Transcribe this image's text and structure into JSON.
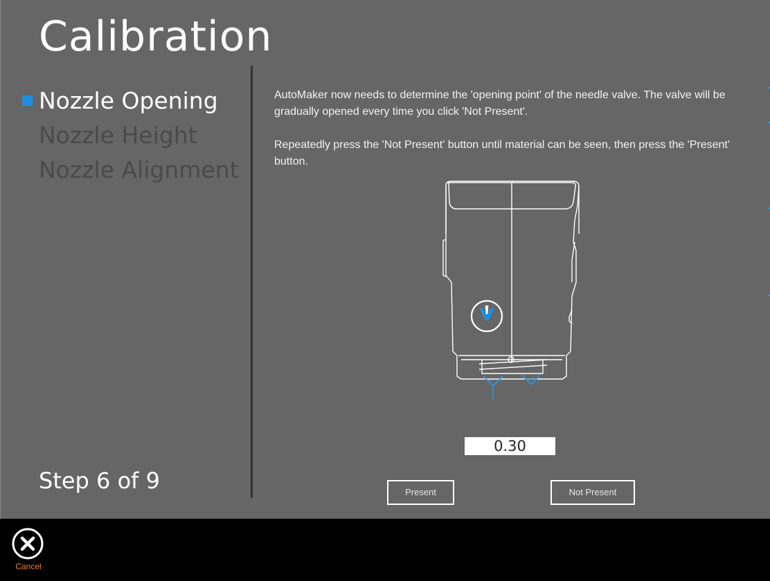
{
  "title": "Calibration",
  "steps": [
    {
      "label": "Nozzle Opening",
      "active": true
    },
    {
      "label": "Nozzle Height",
      "active": false
    },
    {
      "label": "Nozzle Alignment",
      "active": false
    }
  ],
  "step_counter": "Step 6 of 9",
  "instructions": {
    "paragraph_1": "AutoMaker now needs to determine the 'opening point' of the needle valve. The valve will be gradually opened every time you click 'Not Present'.",
    "paragraph_2": "Repeatedly press the 'Not Present' button until material can be seen, then press the 'Present' button."
  },
  "valve_value": "0.30",
  "buttons": {
    "present": "Present",
    "not_present": "Not Present"
  },
  "footer": {
    "cancel_label": "Cancel",
    "cancel_icon": "close-circle-icon"
  },
  "colors": {
    "background": "#666666",
    "accent": "#1e8fe0",
    "cancel_label": "#f07e2a",
    "footer": "#000000"
  }
}
